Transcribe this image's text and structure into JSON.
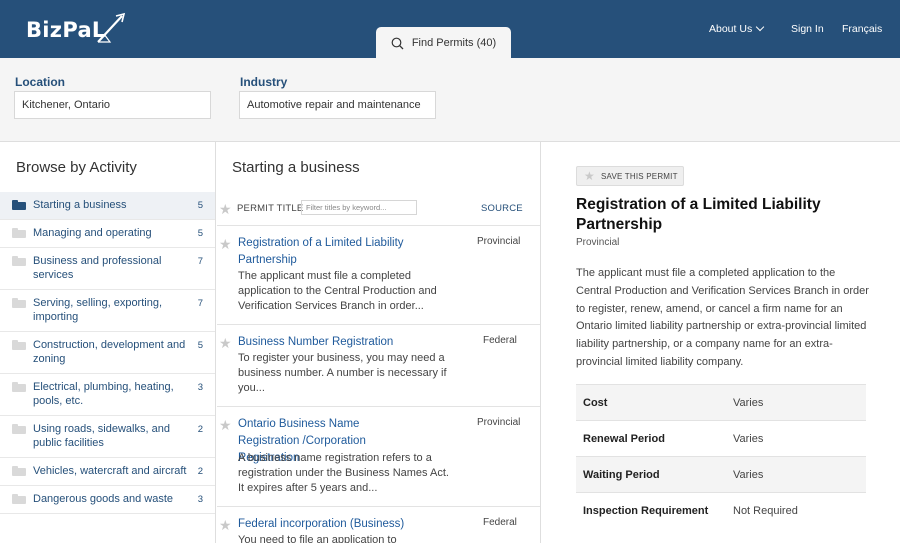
{
  "header": {
    "logo_text": "BizPaL",
    "nav": {
      "about": "About Us",
      "signin": "Sign In",
      "lang": "Français"
    },
    "find_tab": "Find Permits (40)"
  },
  "filters": {
    "location_label": "Location",
    "location_value": "Kitchener, Ontario",
    "industry_label": "Industry",
    "industry_value": "Automotive repair and maintenance"
  },
  "browse": {
    "title": "Browse by Activity",
    "items": [
      {
        "label": "Starting a business",
        "count": "5",
        "active": true
      },
      {
        "label": "Managing and operating",
        "count": "5"
      },
      {
        "label": "Business and professional services",
        "count": "7"
      },
      {
        "label": "Serving, selling, exporting, importing",
        "count": "7"
      },
      {
        "label": "Construction, development and zoning",
        "count": "5"
      },
      {
        "label": "Electrical, plumbing, heating, pools, etc.",
        "count": "3"
      },
      {
        "label": "Using roads, sidewalks, and public facilities",
        "count": "2"
      },
      {
        "label": "Vehicles, watercraft and aircraft",
        "count": "2"
      },
      {
        "label": "Dangerous goods and waste",
        "count": "3"
      }
    ]
  },
  "permits": {
    "title": "Starting a business",
    "head_title": "PERMIT TITLE",
    "filter_placeholder": "Filter titles by keyword...",
    "head_source": "SOURCE",
    "items": [
      {
        "title": "Registration of a Limited Liability Partnership",
        "desc": "The applicant must file a completed application to the Central Production and Verification Services Branch in order...",
        "source": "Provincial"
      },
      {
        "title": "Business Number Registration",
        "desc": "To register your business, you may need a business number. A number is necessary if you...",
        "source": "Federal"
      },
      {
        "title": "Ontario Business Name Registration /Corporation Registration",
        "desc": "A business name registration refers to a registration under the Business Names Act. It expires after 5 years and...",
        "source": "Provincial"
      },
      {
        "title": "Federal incorporation (Business)",
        "desc": "You need to file an application to",
        "source": "Federal"
      }
    ]
  },
  "detail": {
    "save_label": "SAVE THIS PERMIT",
    "title": "Registration of a Limited Liability Partnership",
    "source": "Provincial",
    "description": "The applicant must file a completed application to the Central Production and Verification Services Branch in order to register, renew, amend, or cancel a firm name for an Ontario limited liability partnership or extra-provincial limited liability partnership, or a company name for an extra-provincial limited liability company.",
    "properties": [
      {
        "key": "Cost",
        "value": "Varies"
      },
      {
        "key": "Renewal Period",
        "value": "Varies"
      },
      {
        "key": "Waiting Period",
        "value": "Varies"
      },
      {
        "key": "Inspection Requirement",
        "value": "Not Required"
      }
    ]
  },
  "colors": {
    "brand": "#26507a",
    "link": "#1f5a9b"
  }
}
